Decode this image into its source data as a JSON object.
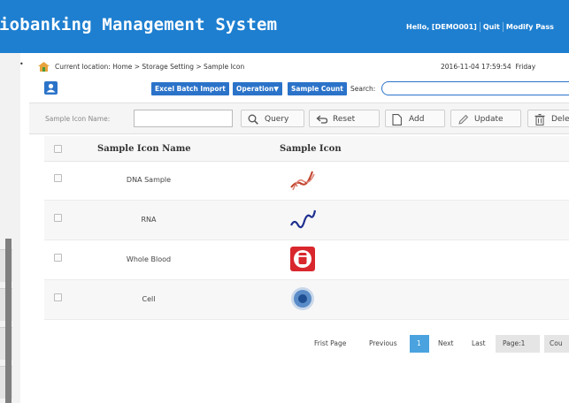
{
  "app": {
    "title": "iobanking Management System",
    "greeting": "Hello, [DEMO001]",
    "quit": "Quit",
    "modify": "Modify Pass"
  },
  "breadcrumb": {
    "text": "Current location: Home > Storage Setting > Sample Icon",
    "datetime": "2016-11-04  17:59:54",
    "weekday": "Friday"
  },
  "toolbar": {
    "excel_import": "Excel Batch Import",
    "operation": "Operation▼",
    "sample_count": "Sample Count",
    "search_label": "Search:",
    "search_value": ""
  },
  "filter": {
    "label": "Sample Icon Name:",
    "value": "",
    "query": "Query",
    "reset": "Reset",
    "add": "Add",
    "update": "Update",
    "delete": "Dele"
  },
  "table": {
    "headers": [
      "Sample Icon Name",
      "Sample Icon"
    ],
    "rows": [
      {
        "name": "DNA Sample",
        "icon": "dna-icon"
      },
      {
        "name": "RNA",
        "icon": "rna-icon"
      },
      {
        "name": "Whole Blood",
        "icon": "blood-tube-icon"
      },
      {
        "name": "Cell",
        "icon": "cell-icon"
      }
    ]
  },
  "pager": {
    "first": "Frist Page",
    "previous": "Previous",
    "current": "1",
    "next": "Next",
    "last": "Last",
    "page": "Page:1",
    "count": "Cou"
  },
  "colors": {
    "header_bg": "#1e7fd0",
    "button_blue": "#2b73c9",
    "pager_current": "#4aa3df"
  }
}
